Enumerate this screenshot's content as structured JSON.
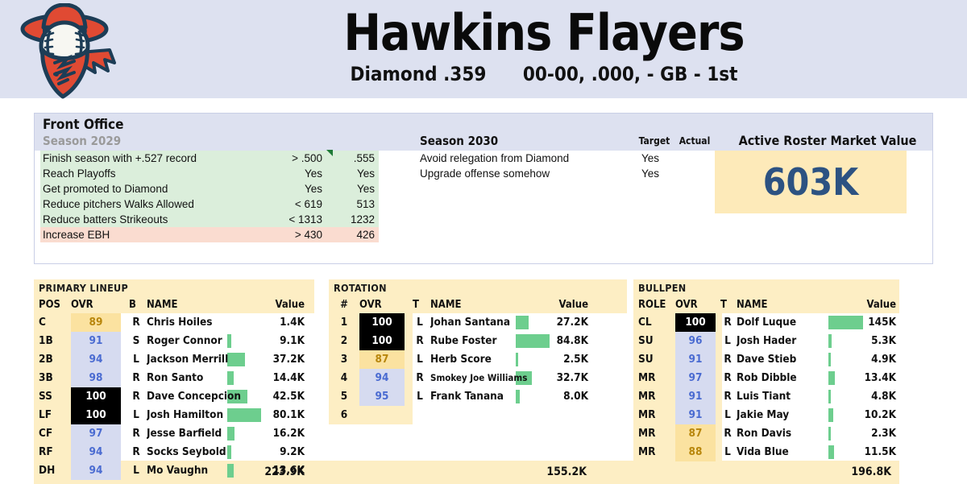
{
  "header": {
    "team_name": "Hawkins Flayers",
    "league": "Diamond .359",
    "record": "00-00, .000, - GB - 1st",
    "logo_name": "cowboy-baseball-logo"
  },
  "front_office": {
    "title": "Front Office",
    "season_left": "Season 2029",
    "season_right": "Season 2030",
    "col_target": "Target",
    "col_actual": "Actual",
    "goals_2029": [
      {
        "label": "Finish season with +.527 record",
        "target": "> .500",
        "actual": ".555",
        "status": "pass",
        "flag": true
      },
      {
        "label": "Reach Playoffs",
        "target": "Yes",
        "actual": "Yes",
        "status": "pass",
        "flag": false
      },
      {
        "label": "Get promoted to Diamond",
        "target": "Yes",
        "actual": "Yes",
        "status": "pass",
        "flag": false
      },
      {
        "label": "Reduce pitchers Walks Allowed",
        "target": "< 619",
        "actual": "513",
        "status": "pass",
        "flag": false
      },
      {
        "label": "Reduce batters Strikeouts",
        "target": "< 1313",
        "actual": "1232",
        "status": "pass",
        "flag": false
      },
      {
        "label": "Increase EBH",
        "target": "> 430",
        "actual": "426",
        "status": "fail",
        "flag": false
      }
    ],
    "goals_2030": [
      {
        "label": "Avoid relegation from Diamond",
        "target": "Yes",
        "actual": ""
      },
      {
        "label": "Upgrade offense somehow",
        "target": "Yes",
        "actual": ""
      }
    ],
    "market_value": {
      "title": "Active Roster Market Value",
      "value": "603K",
      "color": "#2c5282"
    }
  },
  "lineup": {
    "title": "PRIMARY LINEUP",
    "columns": [
      "POS",
      "OVR",
      "B",
      "NAME",
      "Value"
    ],
    "total": "223.9K",
    "rows": [
      {
        "pos": "C",
        "ovr": "89",
        "tier": "low",
        "hand": "R",
        "name": "Chris Hoiles",
        "value": "1.4K",
        "bar": 0
      },
      {
        "pos": "1B",
        "ovr": "91",
        "tier": "mid",
        "hand": "S",
        "name": "Roger Connor",
        "value": "9.1K",
        "bar": 5
      },
      {
        "pos": "2B",
        "ovr": "94",
        "tier": "mid",
        "hand": "L",
        "name": "Jackson Merrill",
        "value": "37.2K",
        "bar": 22
      },
      {
        "pos": "3B",
        "ovr": "98",
        "tier": "mid",
        "hand": "R",
        "name": "Ron Santo",
        "value": "14.4K",
        "bar": 8
      },
      {
        "pos": "SS",
        "ovr": "100",
        "tier": "hi",
        "hand": "R",
        "name": "Dave Concepcion",
        "value": "42.5K",
        "bar": 25
      },
      {
        "pos": "LF",
        "ovr": "100",
        "tier": "hi",
        "hand": "L",
        "name": "Josh Hamilton",
        "value": "80.1K",
        "bar": 42
      },
      {
        "pos": "CF",
        "ovr": "97",
        "tier": "mid",
        "hand": "R",
        "name": "Jesse Barfield",
        "value": "16.2K",
        "bar": 9
      },
      {
        "pos": "RF",
        "ovr": "94",
        "tier": "mid",
        "hand": "R",
        "name": "Socks Seybold",
        "value": "9.2K",
        "bar": 5
      },
      {
        "pos": "DH",
        "ovr": "94",
        "tier": "mid",
        "hand": "L",
        "name": "Mo Vaughn",
        "value": "13.6K",
        "bar": 8
      }
    ]
  },
  "rotation": {
    "title": "ROTATION",
    "columns": [
      "#",
      "OVR",
      "T",
      "NAME",
      "Value"
    ],
    "total": "155.2K",
    "rows": [
      {
        "pos": "1",
        "ovr": "100",
        "tier": "hi",
        "hand": "L",
        "name": "Johan Santana",
        "value": "27.2K",
        "bar": 16,
        "small": false
      },
      {
        "pos": "2",
        "ovr": "100",
        "tier": "hi",
        "hand": "R",
        "name": "Rube Foster",
        "value": "84.8K",
        "bar": 42,
        "small": false
      },
      {
        "pos": "3",
        "ovr": "87",
        "tier": "low",
        "hand": "L",
        "name": "Herb Score",
        "value": "2.5K",
        "bar": 3,
        "small": false
      },
      {
        "pos": "4",
        "ovr": "94",
        "tier": "mid",
        "hand": "R",
        "name": "Smokey Joe Williams",
        "value": "32.7K",
        "bar": 20,
        "small": true
      },
      {
        "pos": "5",
        "ovr": "95",
        "tier": "mid",
        "hand": "L",
        "name": "Frank Tanana",
        "value": "8.0K",
        "bar": 5,
        "small": false
      },
      {
        "pos": "6",
        "ovr": "",
        "tier": "",
        "hand": "",
        "name": "",
        "value": "",
        "bar": 0,
        "small": false
      }
    ]
  },
  "bullpen": {
    "title": "BULLPEN",
    "columns": [
      "ROLE",
      "OVR",
      "T",
      "NAME",
      "Value"
    ],
    "total": "196.8K",
    "rows": [
      {
        "pos": "CL",
        "ovr": "100",
        "tier": "hi",
        "hand": "R",
        "name": "Dolf Luque",
        "value": "145K",
        "bar": 43
      },
      {
        "pos": "SU",
        "ovr": "96",
        "tier": "mid",
        "hand": "L",
        "name": "Josh Hader",
        "value": "5.3K",
        "bar": 4
      },
      {
        "pos": "SU",
        "ovr": "91",
        "tier": "mid",
        "hand": "R",
        "name": "Dave Stieb",
        "value": "4.9K",
        "bar": 3
      },
      {
        "pos": "MR",
        "ovr": "97",
        "tier": "mid",
        "hand": "R",
        "name": "Rob Dibble",
        "value": "13.4K",
        "bar": 8
      },
      {
        "pos": "MR",
        "ovr": "91",
        "tier": "mid",
        "hand": "R",
        "name": "Luis Tiant",
        "value": "4.8K",
        "bar": 3
      },
      {
        "pos": "MR",
        "ovr": "91",
        "tier": "mid",
        "hand": "L",
        "name": "Jakie May",
        "value": "10.2K",
        "bar": 6
      },
      {
        "pos": "MR",
        "ovr": "87",
        "tier": "low",
        "hand": "R",
        "name": "Ron Davis",
        "value": "2.3K",
        "bar": 3
      },
      {
        "pos": "MR",
        "ovr": "88",
        "tier": "low",
        "hand": "L",
        "name": "Vida Blue",
        "value": "11.5K",
        "bar": 7
      }
    ]
  },
  "colors": {
    "header_bg": "#dde1f0",
    "section_bg": "#fdeec4",
    "bar_green": "#6dce8e",
    "pass_green": "#dbeedb",
    "fail_red": "#fadcd0",
    "ovr_high_bg": "#000000",
    "ovr_mid_bg": "#d6dbf0",
    "ovr_low_bg": "#fbe2a0"
  }
}
